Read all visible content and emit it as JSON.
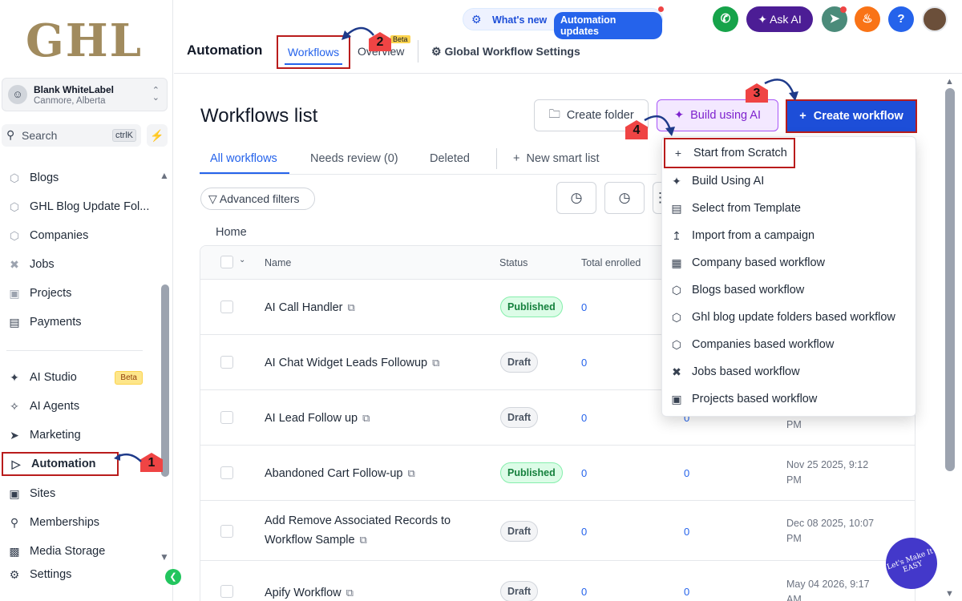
{
  "logo_text": "GHL",
  "account": {
    "name": "Blank WhiteLabel",
    "location": "Canmore, Alberta"
  },
  "search": {
    "label": "Search",
    "shortcut": "ctrlK"
  },
  "sidebar": {
    "items": [
      {
        "label": "Blogs",
        "icon": "cube-icon"
      },
      {
        "label": "GHL Blog Update Fol...",
        "icon": "cube-icon"
      },
      {
        "label": "Companies",
        "icon": "cube-icon"
      },
      {
        "label": "Jobs",
        "icon": "tools-icon"
      },
      {
        "label": "Projects",
        "icon": "briefcase-icon"
      },
      {
        "label": "Payments",
        "icon": "receipt-icon"
      },
      {
        "label": "AI Studio",
        "icon": "ai-studio-icon",
        "badge": "Beta"
      },
      {
        "label": "AI Agents",
        "icon": "sparkle-icon"
      },
      {
        "label": "Marketing",
        "icon": "send-icon"
      },
      {
        "label": "Automation",
        "icon": "play-circle-icon"
      },
      {
        "label": "Sites",
        "icon": "globe-icon"
      },
      {
        "label": "Memberships",
        "icon": "award-icon"
      },
      {
        "label": "Media Storage",
        "icon": "image-icon"
      },
      {
        "label": "Settings",
        "icon": "gear-icon"
      }
    ]
  },
  "header": {
    "whats_new": "What's new",
    "automation_updates": "Automation updates",
    "ask_ai": "Ask AI",
    "page_title": "Automation",
    "tabs": {
      "workflows": "Workflows",
      "overview": "Overview",
      "beta": "Beta"
    },
    "global_settings": "Global Workflow Settings"
  },
  "main": {
    "title": "Workflows list",
    "create_folder": "Create folder",
    "build_ai": "Build using AI",
    "create_workflow": "Create workflow",
    "subtabs": {
      "all": "All workflows",
      "review": "Needs review (0)",
      "deleted": "Deleted",
      "smart": "New smart list"
    },
    "advanced_filters": "Advanced filters",
    "breadcrumb": "Home",
    "columns": {
      "name": "Name",
      "status": "Status",
      "enrolled": "Total enrolled"
    },
    "rows": [
      {
        "name": "AI Call Handler",
        "status": "Published",
        "enrolled": "0"
      },
      {
        "name": "AI Chat Widget Leads Followup",
        "status": "Draft",
        "enrolled": "0"
      },
      {
        "name": "AI Lead Follow up",
        "status": "Draft",
        "enrolled": "0",
        "active": "0",
        "date_l2": "PM"
      },
      {
        "name": "Abandoned Cart Follow-up",
        "status": "Published",
        "enrolled": "0",
        "active": "0",
        "date_l1": "Nov 25 2025, 9:12",
        "date_l2": "PM"
      },
      {
        "name_l1": "Add Remove Associated Records to",
        "name_l2": "Workflow Sample",
        "status": "Draft",
        "enrolled": "0",
        "active": "0",
        "date_l1": "Dec 08 2025, 10:07",
        "date_l2": "PM"
      },
      {
        "name": "Apify Workflow",
        "status": "Draft",
        "enrolled": "0",
        "active": "0",
        "date_l1": "May 04 2026, 9:17",
        "date_l2": "AM"
      }
    ]
  },
  "dropdown": {
    "items": [
      {
        "label": "Start from Scratch",
        "icon": "plus-icon"
      },
      {
        "label": "Build Using AI",
        "icon": "sparkle-icon"
      },
      {
        "label": "Select from Template",
        "icon": "template-icon"
      },
      {
        "label": "Import from a campaign",
        "icon": "upload-icon"
      },
      {
        "label": "Company based workflow",
        "icon": "building-icon"
      },
      {
        "label": "Blogs based workflow",
        "icon": "cube-icon"
      },
      {
        "label": "Ghl blog update folders based workflow",
        "icon": "cube-icon"
      },
      {
        "label": "Companies based workflow",
        "icon": "cube-icon"
      },
      {
        "label": "Jobs based workflow",
        "icon": "tools-icon"
      },
      {
        "label": "Projects based workflow",
        "icon": "briefcase-icon"
      }
    ]
  },
  "steps": [
    "1",
    "2",
    "3",
    "4"
  ],
  "badge_text": "Let's Make It EASY",
  "colors": {
    "accent": "#2563eb",
    "highlight": "#b91c1c",
    "published": "#15803d"
  }
}
